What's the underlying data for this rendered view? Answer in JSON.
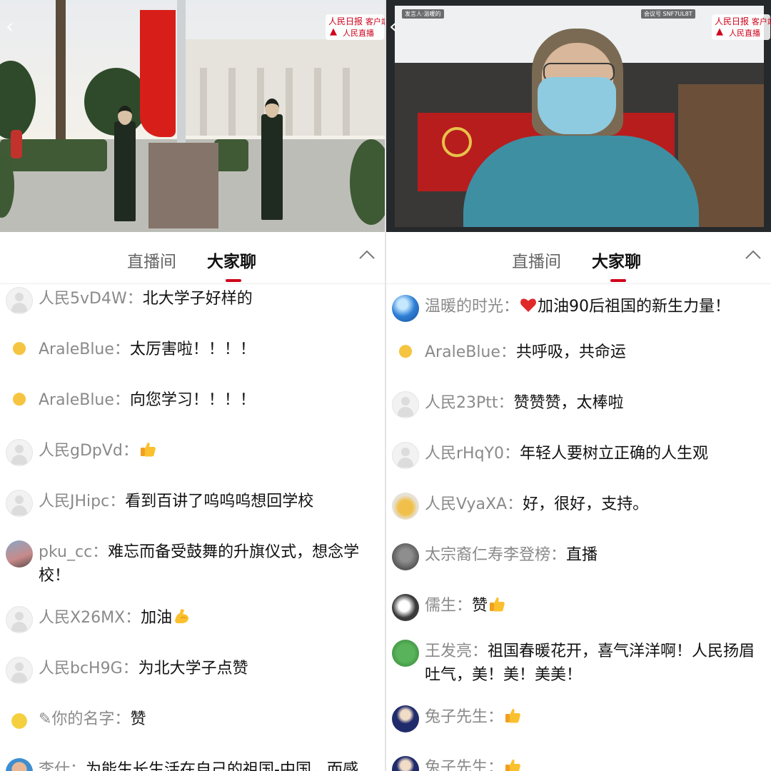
{
  "left": {
    "logo": {
      "brand": "人民日报",
      "client": "客户端",
      "live": "人民直播"
    },
    "tabs": {
      "live_room": "直播间",
      "chat": "大家聊"
    },
    "comments": [
      {
        "user": "人民5vD4W：",
        "text": "北大学子好样的",
        "avatar": "default-avatar"
      },
      {
        "user": "AraleBlue：",
        "text": "太厉害啦！！！！",
        "avatar": "giraffe-avatar"
      },
      {
        "user": "AraleBlue：",
        "text": "向您学习！！！！",
        "avatar": "giraffe-avatar"
      },
      {
        "user": "人民gDpVd：",
        "text": "",
        "emoji": "thumbs-up",
        "avatar": "default-avatar"
      },
      {
        "user": "人民JHipc：",
        "text": "看到百讲了呜呜呜想回学校",
        "avatar": "default-avatar"
      },
      {
        "user": "pku_cc：",
        "text": "难忘而备受鼓舞的升旗仪式，想念学校！",
        "avatar": "photo-avatar"
      },
      {
        "user": "人民X26MX：",
        "text": "加油",
        "emoji": "flexed-biceps",
        "avatar": "default-avatar"
      },
      {
        "user": "人民bcH9G：",
        "text": "为北大学子点赞",
        "avatar": "default-avatar"
      },
      {
        "user": "✎你的名字：",
        "text": "赞",
        "avatar": "sponge-avatar"
      },
      {
        "user": "李仕：",
        "text": "为能生长生活在自己的祖国-中国，而感到骄傲和自豪！中国加油！世界加",
        "avatar": "man-avatar"
      }
    ]
  },
  "right": {
    "logo": {
      "brand": "人民日报",
      "client": "客户端",
      "live": "人民直播"
    },
    "video_tags": {
      "meeting_id": "SNF7UL8T",
      "join": "发言人·温暖的",
      "code": "会议号"
    },
    "tabs": {
      "live_room": "直播间",
      "chat": "大家聊"
    },
    "comments": [
      {
        "user": "温暖的时光：",
        "text": "加油90后祖国的新生力量！",
        "emoji_before": "red-heart",
        "avatar": "planet-avatar"
      },
      {
        "user": "AraleBlue：",
        "text": "共呼吸，共命运",
        "avatar": "giraffe-avatar"
      },
      {
        "user": "人民23Ptt：",
        "text": "赞赞赞，太棒啦",
        "avatar": "default-avatar"
      },
      {
        "user": "人民rHqY0：",
        "text": "年轻人要树立正确的人生观",
        "avatar": "default-avatar"
      },
      {
        "user": "人民VyaXA：",
        "text": "好，很好，支持。",
        "avatar": "sun-avatar"
      },
      {
        "user": "太宗裔仁寿李登榜：",
        "text": "直播",
        "avatar": "gray-avatar"
      },
      {
        "user": "儒生：",
        "text": "赞",
        "emoji": "thumbs-up",
        "avatar": "flower-avatar"
      },
      {
        "user": "王发亮：",
        "text": "祖国春暖花开，喜气洋洋啊！人民扬眉吐气，美！美！美美！",
        "avatar": "green-avatar"
      },
      {
        "user": "兔子先生：",
        "text": "",
        "emoji": "thumbs-up",
        "avatar": "anime-avatar"
      },
      {
        "user": "兔子先生：",
        "text": "",
        "emoji": "thumbs-up",
        "avatar": "anime-avatar"
      }
    ]
  },
  "colors": {
    "accent": "#d0021b",
    "username": "#8a8a8a",
    "text": "#111111",
    "tab_inactive": "#666666"
  }
}
